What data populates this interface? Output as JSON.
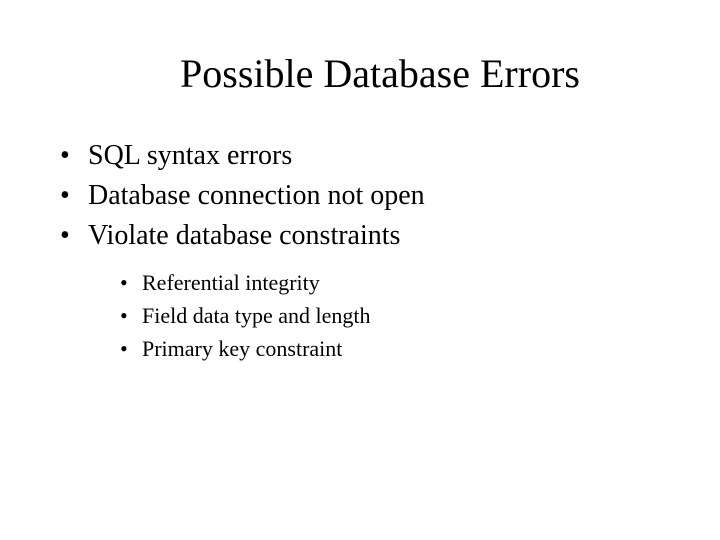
{
  "slide": {
    "title": "Possible Database Errors",
    "bullets": [
      "SQL syntax errors",
      "Database connection not open",
      "Violate database constraints"
    ],
    "sub_bullets": [
      "Referential integrity",
      "Field data type and length",
      "Primary key constraint"
    ]
  }
}
